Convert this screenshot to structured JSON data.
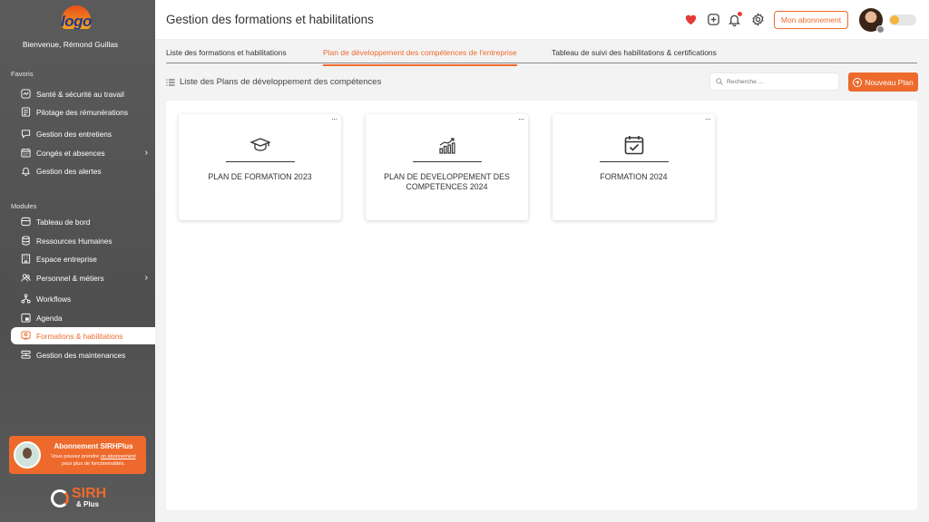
{
  "sidebar": {
    "logo_text": "logo",
    "welcome": "Bienvenue, Rémond Guillas",
    "favoris_title": "Favoris",
    "favoris": [
      {
        "label": "Santé & sécurité au travail",
        "icon": "health-icon"
      },
      {
        "label": "Pilotage des rémunérations",
        "icon": "payroll-icon"
      },
      {
        "label": "Gestion des entretiens",
        "icon": "chat-icon"
      },
      {
        "label": "Congés et absences",
        "icon": "calendar-icon",
        "chevron": true
      },
      {
        "label": "Gestion des alertes",
        "icon": "bell-icon"
      }
    ],
    "modules_title": "Modules",
    "modules": [
      {
        "label": "Tableau de bord",
        "icon": "dashboard-icon"
      },
      {
        "label": "Ressources Humaines",
        "icon": "database-icon"
      },
      {
        "label": "Espace entreprise",
        "icon": "building-icon"
      },
      {
        "label": "Personnel & métiers",
        "icon": "people-icon",
        "chevron": true
      },
      {
        "label": "Workflows",
        "icon": "workflow-icon"
      },
      {
        "label": "Agenda",
        "icon": "agenda-icon"
      },
      {
        "label": "Formations & habilitations",
        "icon": "training-icon",
        "active": true
      },
      {
        "label": "Gestion des maintenances",
        "icon": "maintenance-icon"
      }
    ],
    "promo": {
      "title": "Abonnement SIRHPlus",
      "text_before": "Vous pouvez prendre ",
      "link": "un abonnement",
      "text_after": " pour plus de fonctionnalités."
    },
    "brand": {
      "name": "SIRH",
      "suffix": "& Plus"
    }
  },
  "header": {
    "title": "Gestion des formations et habilitations",
    "subscription_label": "Mon abonnement"
  },
  "tabs": [
    {
      "label": "Liste des formations et habilitations",
      "active": false
    },
    {
      "label": "Plan de développement des compétences de l'entreprise",
      "active": true
    },
    {
      "label": "Tableau de suivi des habilitations & certifications",
      "active": false
    }
  ],
  "toolbar": {
    "list_title": "Liste des Plans de développement des compétences",
    "search_placeholder": "Recherche ...",
    "new_button": "Nouveau Plan"
  },
  "cards": [
    {
      "title": "PLAN DE FORMATION 2023",
      "icon": "graduation-cap-icon",
      "menu": "···"
    },
    {
      "title": "PLAN DE DEVELOPPEMENT DES COMPETENCES 2024",
      "icon": "growth-chart-icon",
      "menu": "···"
    },
    {
      "title": "FORMATION 2024",
      "icon": "calendar-check-icon",
      "menu": "···"
    }
  ],
  "colors": {
    "accent": "#ee6a2c",
    "sidebar": "#555555",
    "alert": "#e53935"
  }
}
